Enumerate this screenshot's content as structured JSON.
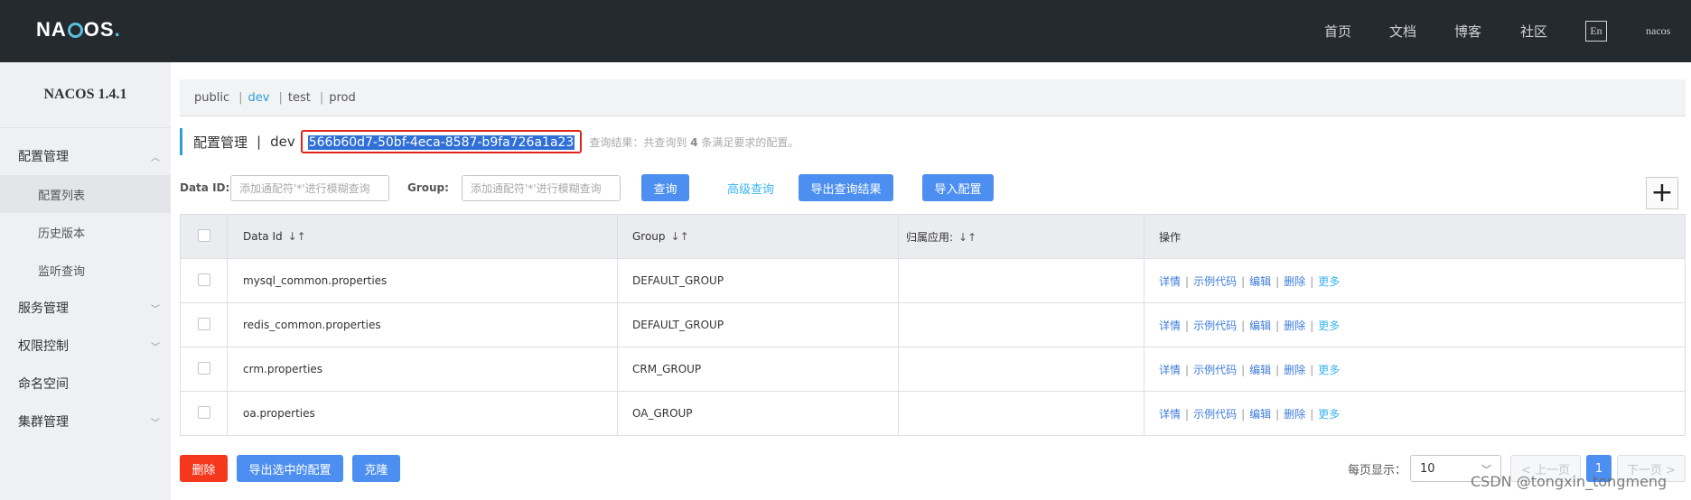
{
  "header": {
    "logo_text": "NACOS.",
    "nav": [
      "首页",
      "文档",
      "博客",
      "社区"
    ],
    "lang_button": "En",
    "user": "nacos"
  },
  "sidebar": {
    "version": "NACOS 1.4.1",
    "items": [
      {
        "label": "配置管理",
        "expanded": true
      },
      {
        "label": "配置列表",
        "sub": true,
        "active": true
      },
      {
        "label": "历史版本",
        "sub": true
      },
      {
        "label": "监听查询",
        "sub": true
      },
      {
        "label": "服务管理",
        "expanded": false
      },
      {
        "label": "权限控制",
        "expanded": false
      },
      {
        "label": "命名空间"
      },
      {
        "label": "集群管理",
        "expanded": false
      }
    ]
  },
  "namespaces": {
    "items": [
      "public",
      "dev",
      "test",
      "prod"
    ],
    "active": "dev",
    "separator": "|"
  },
  "title": {
    "text": "配置管理",
    "separator": "|",
    "namespace": "dev",
    "namespace_id": "566b60d7-50bf-4eca-8587-b9fa726a1a23",
    "result_prefix": "查询结果：共查询到",
    "result_count": "4",
    "result_suffix": "条满足要求的配置。"
  },
  "search": {
    "dataid_label": "Data ID:",
    "dataid_placeholder": "添加通配符'*'进行模糊查询",
    "group_label": "Group:",
    "group_placeholder": "添加通配符'*'进行模糊查询",
    "query_button": "查询",
    "advanced_link": "高级查询",
    "export_button": "导出查询结果",
    "import_button": "导入配置",
    "add_button": "+"
  },
  "table": {
    "headers": [
      "Data Id",
      "Group",
      "归属应用:",
      "操作"
    ],
    "rows": [
      {
        "data_id": "mysql_common.properties",
        "group": "DEFAULT_GROUP",
        "app": ""
      },
      {
        "data_id": "redis_common.properties",
        "group": "DEFAULT_GROUP",
        "app": ""
      },
      {
        "data_id": "crm.properties",
        "group": "CRM_GROUP",
        "app": ""
      },
      {
        "data_id": "oa.properties",
        "group": "OA_GROUP",
        "app": ""
      }
    ],
    "ops": [
      "详情",
      "示例代码",
      "编辑",
      "删除",
      "更多"
    ]
  },
  "footer": {
    "delete_button": "删除",
    "export_selected_button": "导出选中的配置",
    "clone_button": "克隆",
    "per_page_label": "每页显示：",
    "per_page_value": "10",
    "prev": "< 上一页",
    "current_page": "1",
    "next": "下一页 >"
  },
  "watermark": "CSDN @tongxin_tongmeng",
  "colors": {
    "topbar": "#252a2f",
    "accent": "#4c8ff0",
    "danger": "#f5371e",
    "link": "#3bb4f2",
    "highlight_border": "#e1251b"
  }
}
